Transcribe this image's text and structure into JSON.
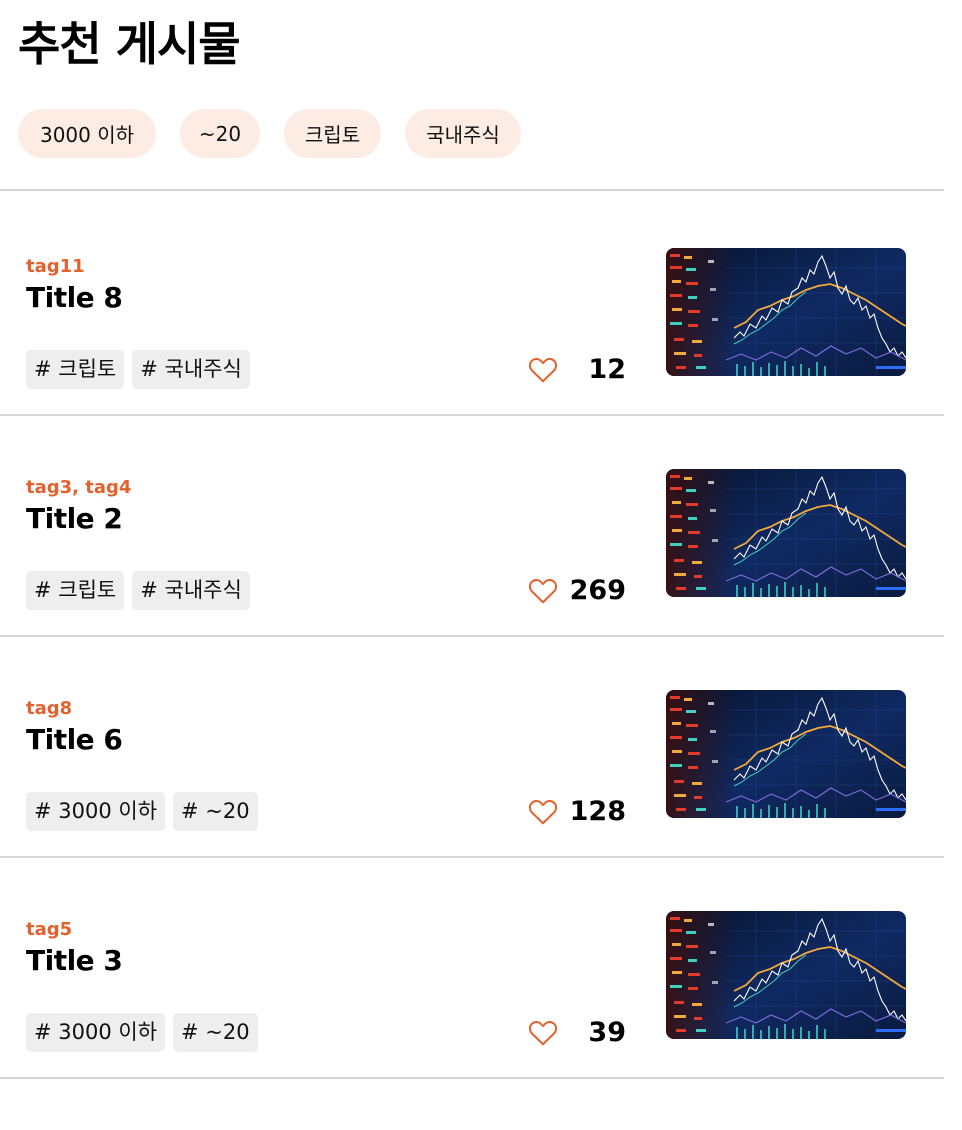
{
  "page_title": "추천 게시물",
  "filters": [
    {
      "label": "3000 이하"
    },
    {
      "label": "~20"
    },
    {
      "label": "크립토"
    },
    {
      "label": "국내주식"
    }
  ],
  "posts": [
    {
      "category": "tag11",
      "title": "Title 8",
      "hashtags": [
        "# 크립토",
        "# 국내주식"
      ],
      "likes": "12"
    },
    {
      "category": "tag3, tag4",
      "title": "Title 2",
      "hashtags": [
        "# 크립토",
        "# 국내주식"
      ],
      "likes": "269"
    },
    {
      "category": "tag8",
      "title": "Title 6",
      "hashtags": [
        "# 3000 이하",
        "# ~20"
      ],
      "likes": "128"
    },
    {
      "category": "tag5",
      "title": "Title 3",
      "hashtags": [
        "# 3000 이하",
        "# ~20"
      ],
      "likes": "39"
    }
  ],
  "colors": {
    "accent": "#e2622f",
    "chip_bg": "#fdece3",
    "hashtag_bg": "#eeeeee",
    "divider": "#d6d6d6"
  },
  "icons": {
    "like": "heart-outline-icon"
  }
}
